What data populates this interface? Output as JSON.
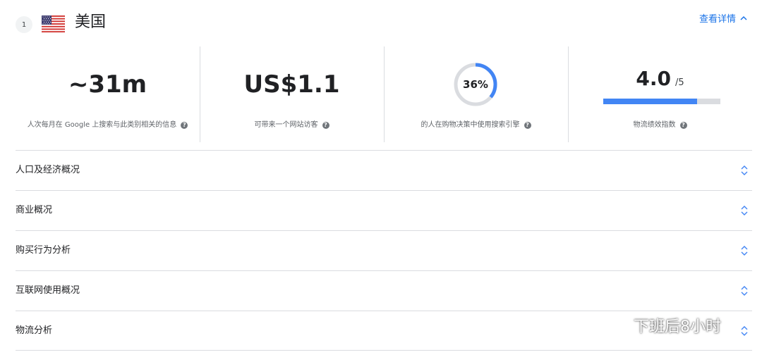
{
  "header": {
    "rank": "1",
    "country": "美国",
    "flag_icon": "us-flag-icon",
    "details_label": "查看详情",
    "accent_color": "#1a73e8"
  },
  "stats": [
    {
      "value": "~31m",
      "label": "人次每月在 Google 上搜索与此类别相关的信息"
    },
    {
      "value": "US$1.1",
      "label": "可带来一个网站访客"
    },
    {
      "value": "36%",
      "percent": 36,
      "label": "的人在购物决策中使用搜索引擎"
    },
    {
      "value": "4.0",
      "max": "/5",
      "fraction": 0.8,
      "label": "物流绩效指数"
    }
  ],
  "sections": [
    {
      "title": "人口及经济概况"
    },
    {
      "title": "商业概况"
    },
    {
      "title": "购买行为分析"
    },
    {
      "title": "互联网使用概况"
    },
    {
      "title": "物流分析"
    }
  ],
  "watermark": {
    "text": "下班后8小时"
  },
  "colors": {
    "progress": "#4285f4",
    "track": "#dadce0",
    "text": "#202124"
  }
}
